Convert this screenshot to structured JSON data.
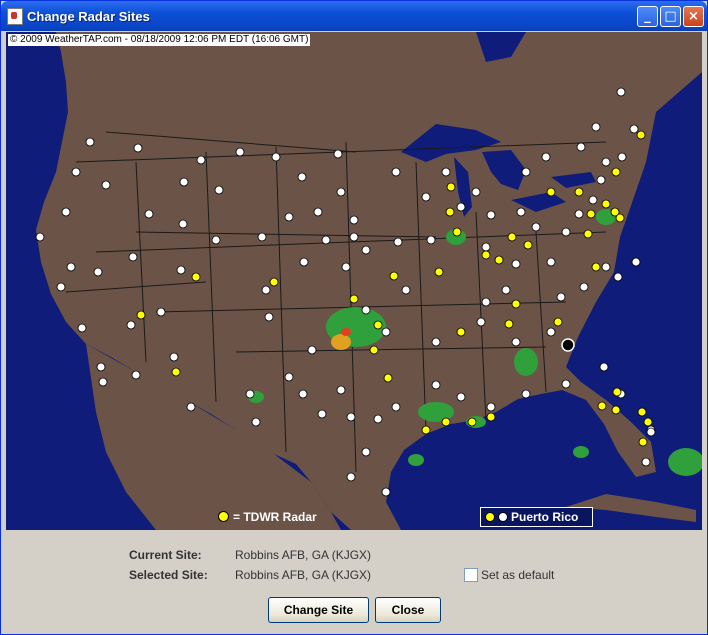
{
  "window": {
    "title": "Change Radar Sites",
    "controls": {
      "minimize": "_",
      "maximize": "□",
      "close": "×"
    }
  },
  "map": {
    "copyright": "© 2009 WeatherTAP.com - 08/18/2009 12:06 PM EDT (16:06 GMT)",
    "legend_tdwr": "= TDWR Radar",
    "puerto_rico_label": "Puerto Rico",
    "colors": {
      "ocean": "#0f1c7a",
      "land": "#6b5447",
      "borders": "#1a1a1a",
      "nexrad_site": "#ffffff",
      "tdwr_site": "#ffff00",
      "selected_site": "#000000",
      "precip": "#2fa03c"
    }
  },
  "info": {
    "current_site_label": "Current Site:",
    "current_site_value": "Robbins AFB, GA (KJGX)",
    "selected_site_label": "Selected Site:",
    "selected_site_value": "Robbins AFB, GA (KJGX)",
    "set_default_label": "Set as default",
    "set_default_checked": false
  },
  "buttons": {
    "change_site": "Change Site",
    "close": "Close"
  }
}
